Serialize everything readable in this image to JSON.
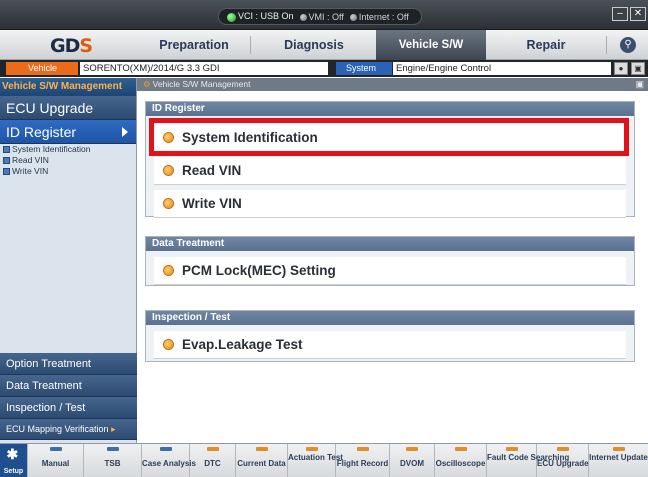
{
  "status": {
    "vci": "VCI : USB On",
    "vmi": "VMI : Off",
    "internet": "Internet : Off"
  },
  "window": {
    "minimize": "–",
    "close": "✕"
  },
  "menu": {
    "logo_main": "GD",
    "logo_accent": "S",
    "items": [
      "Preparation",
      "Diagnosis",
      "Vehicle S/W Management",
      "Repair"
    ],
    "active_index": 2
  },
  "vehicle_bar": {
    "vehicle_label": "Vehicle",
    "vehicle_value": "SORENTO(XM)/2014/G 3.3 GDI",
    "system_label": "System",
    "system_value": "Engine/Engine Control"
  },
  "sidebar": {
    "header": "Vehicle S/W Management",
    "nav": [
      "ECU Upgrade",
      "ID Register"
    ],
    "sub_items": [
      "System Identification",
      "Read VIN",
      "Write VIN"
    ],
    "bottom": [
      "Option Treatment",
      "Data Treatment",
      "Inspection / Test",
      "ECU Mapping Verification"
    ]
  },
  "breadcrumb": "Vehicle S/W Management",
  "sections": {
    "id_register": {
      "title": "ID Register",
      "rows": [
        "System Identification",
        "Read VIN",
        "Write VIN"
      ]
    },
    "data_treatment": {
      "title": "Data Treatment",
      "rows": [
        "PCM Lock(MEC) Setting"
      ]
    },
    "inspection": {
      "title": "Inspection / Test",
      "rows": [
        "Evap.Leakage Test"
      ]
    }
  },
  "toolbar": {
    "setup": "Setup",
    "buttons": [
      "Manual",
      "TSB",
      "Case Analysis",
      "DTC",
      "Current Data",
      "Actuation Test",
      "Flight Record",
      "DVOM",
      "Oscilloscope",
      "Fault Code Searching",
      "ECU Upgrade",
      "Internet Update"
    ]
  },
  "colors": {
    "highlight": "#e31219",
    "accent": "#ea6b1c",
    "system": "#2a63b5"
  }
}
